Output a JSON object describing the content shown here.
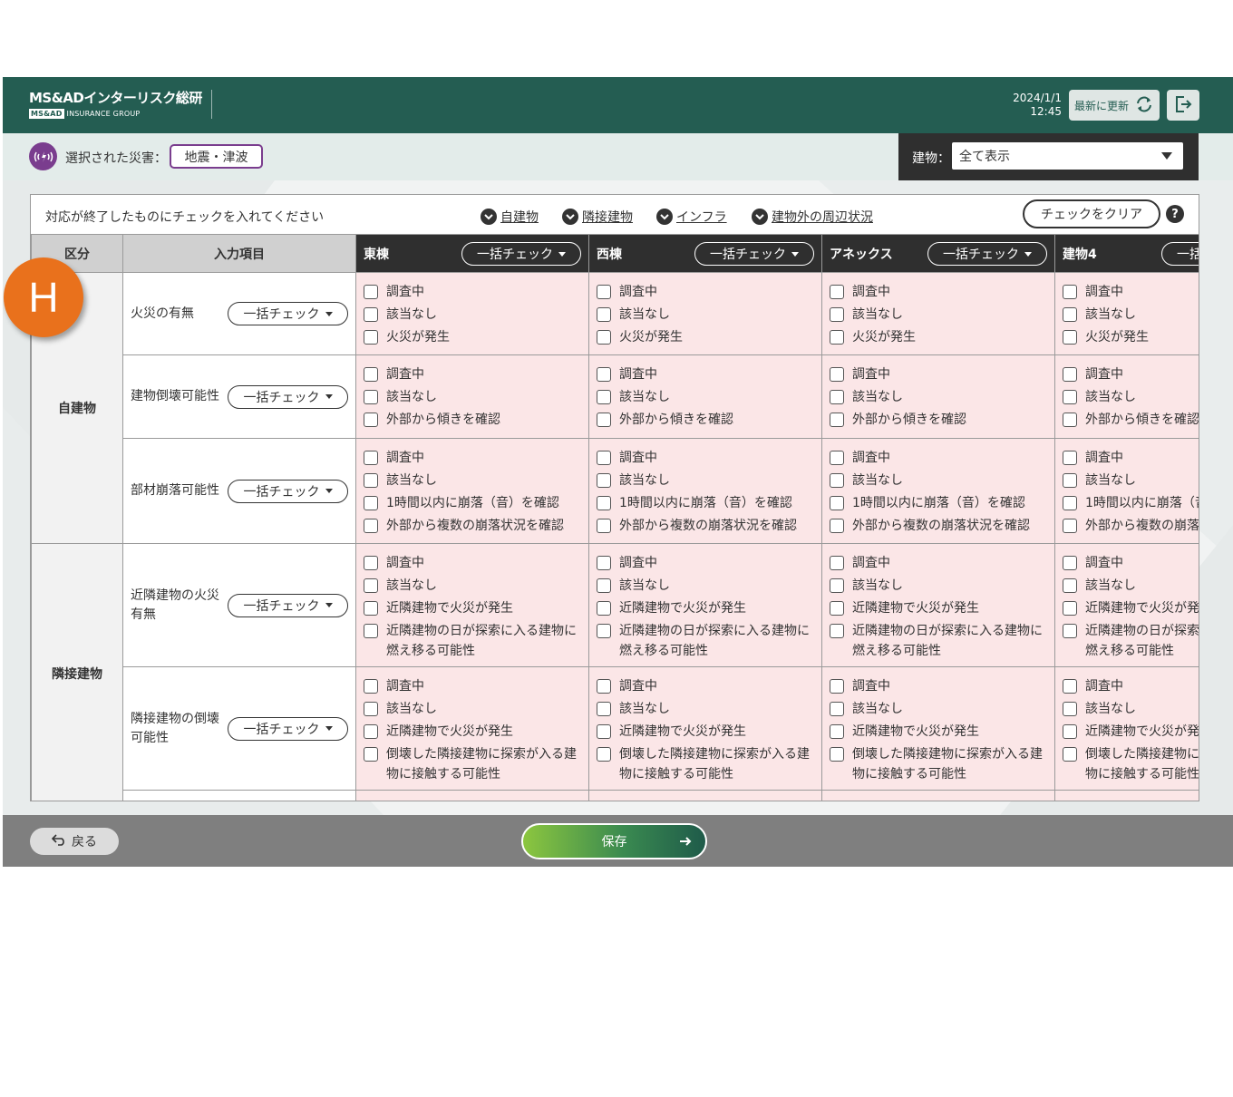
{
  "header": {
    "company": "MS&ADインターリスク総研",
    "badge": "MS&AD",
    "group": "INSURANCE GROUP",
    "date": "2024/1/1",
    "time": "12:45",
    "refresh_label": "最新に更新"
  },
  "filter": {
    "disaster_label": "選択された災害：",
    "disaster_value": "地震・津波",
    "building_label": "建物：",
    "building_value": "全て表示"
  },
  "panel": {
    "instruction": "対応が終了したものにチェックを入れてください",
    "jumps": [
      "自建物",
      "隣接建物",
      "インフラ",
      "建物外の周辺状況"
    ],
    "clear_label": "チェックをクリア",
    "help": "?"
  },
  "table": {
    "col_category": "区分",
    "col_item": "入力項目",
    "bulk_label": "一括チェック",
    "buildings": [
      "東棟",
      "西棟",
      "アネックス",
      "建物4"
    ],
    "categories": [
      "自建物",
      "隣接建物"
    ],
    "rows": [
      {
        "item": "火災の有無",
        "options": [
          "調査中",
          "該当なし",
          "火災が発生"
        ]
      },
      {
        "item": "建物倒壊可能性",
        "options": [
          "調査中",
          "該当なし",
          "外部から傾きを確認"
        ]
      },
      {
        "item": "部材崩落可能性",
        "options": [
          "調査中",
          "該当なし",
          "1時間以内に崩落（音）を確認",
          "外部から複数の崩落状況を確認"
        ]
      },
      {
        "item": "近隣建物の火災有無",
        "options": [
          "調査中",
          "該当なし",
          "近隣建物で火災が発生",
          "近隣建物の日が探索に入る建物に燃え移る可能性"
        ]
      },
      {
        "item": "隣接建物の倒壊可能性",
        "options": [
          "調査中",
          "該当なし",
          "近隣建物で火災が発生",
          "倒壊した隣接建物に探索が入る建物に接触する可能性"
        ]
      }
    ]
  },
  "footer": {
    "back_label": "戻る",
    "save_label": "保存"
  },
  "marker": {
    "letter": "H"
  },
  "colors": {
    "header": "#245d52",
    "accent_purple": "#7a3d8e",
    "cell_pink": "#fbe6e7",
    "marker_orange": "#e9711c",
    "building_header": "#2f2f2f"
  }
}
